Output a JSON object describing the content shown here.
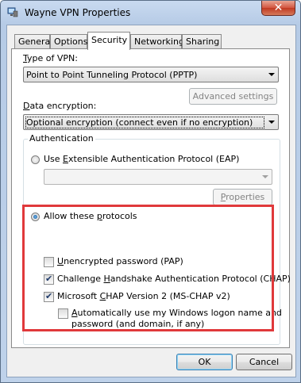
{
  "window": {
    "title": "Wayne VPN Properties",
    "close_glyph": "✕"
  },
  "tabs": [
    {
      "label": "General",
      "active": false
    },
    {
      "label": "Options",
      "active": false
    },
    {
      "label": "Security",
      "active": true
    },
    {
      "label": "Networking",
      "active": false
    },
    {
      "label": "Sharing",
      "active": false
    }
  ],
  "vpn_type": {
    "label_pre": "",
    "label_u": "T",
    "label_post": "ype of VPN:",
    "value": "Point to Point Tunneling Protocol (PPTP)"
  },
  "advanced_button": "Advanced settings",
  "encryption": {
    "label_pre": "",
    "label_u": "D",
    "label_post": "ata encryption:",
    "value": "Optional encryption (connect even if no encryption)"
  },
  "authentication": {
    "group_label": "Authentication",
    "eap_radio": {
      "pre": "Use ",
      "u": "E",
      "post": "xtensible Authentication Protocol (EAP)",
      "checked": false
    },
    "eap_combo_value": "",
    "properties_button": {
      "u": "P",
      "post": "roperties"
    },
    "allow_radio": {
      "pre": "Allow these ",
      "u": "p",
      "post": "rotocols",
      "checked": true
    },
    "protocols": [
      {
        "pre": "",
        "u": "U",
        "post": "nencrypted password (PAP)",
        "checked": false
      },
      {
        "pre": "Challenge ",
        "u": "H",
        "post": "andshake Authentication Protocol (CHAP)",
        "checked": true
      },
      {
        "pre": "Microsoft ",
        "u": "C",
        "post": "HAP Version 2 (MS-CHAP v2)",
        "checked": true
      }
    ],
    "auto_logon": {
      "line1_pre": "",
      "line1_u": "A",
      "line1_post": "utomatically use my Windows logon name and",
      "line2": "password (and domain, if any)",
      "checked": false
    }
  },
  "footer": {
    "ok": "OK",
    "cancel": "Cancel"
  },
  "colors": {
    "highlight": "#e0393b",
    "title_bg": "#c9daf0",
    "close_red": "#c13a22"
  }
}
